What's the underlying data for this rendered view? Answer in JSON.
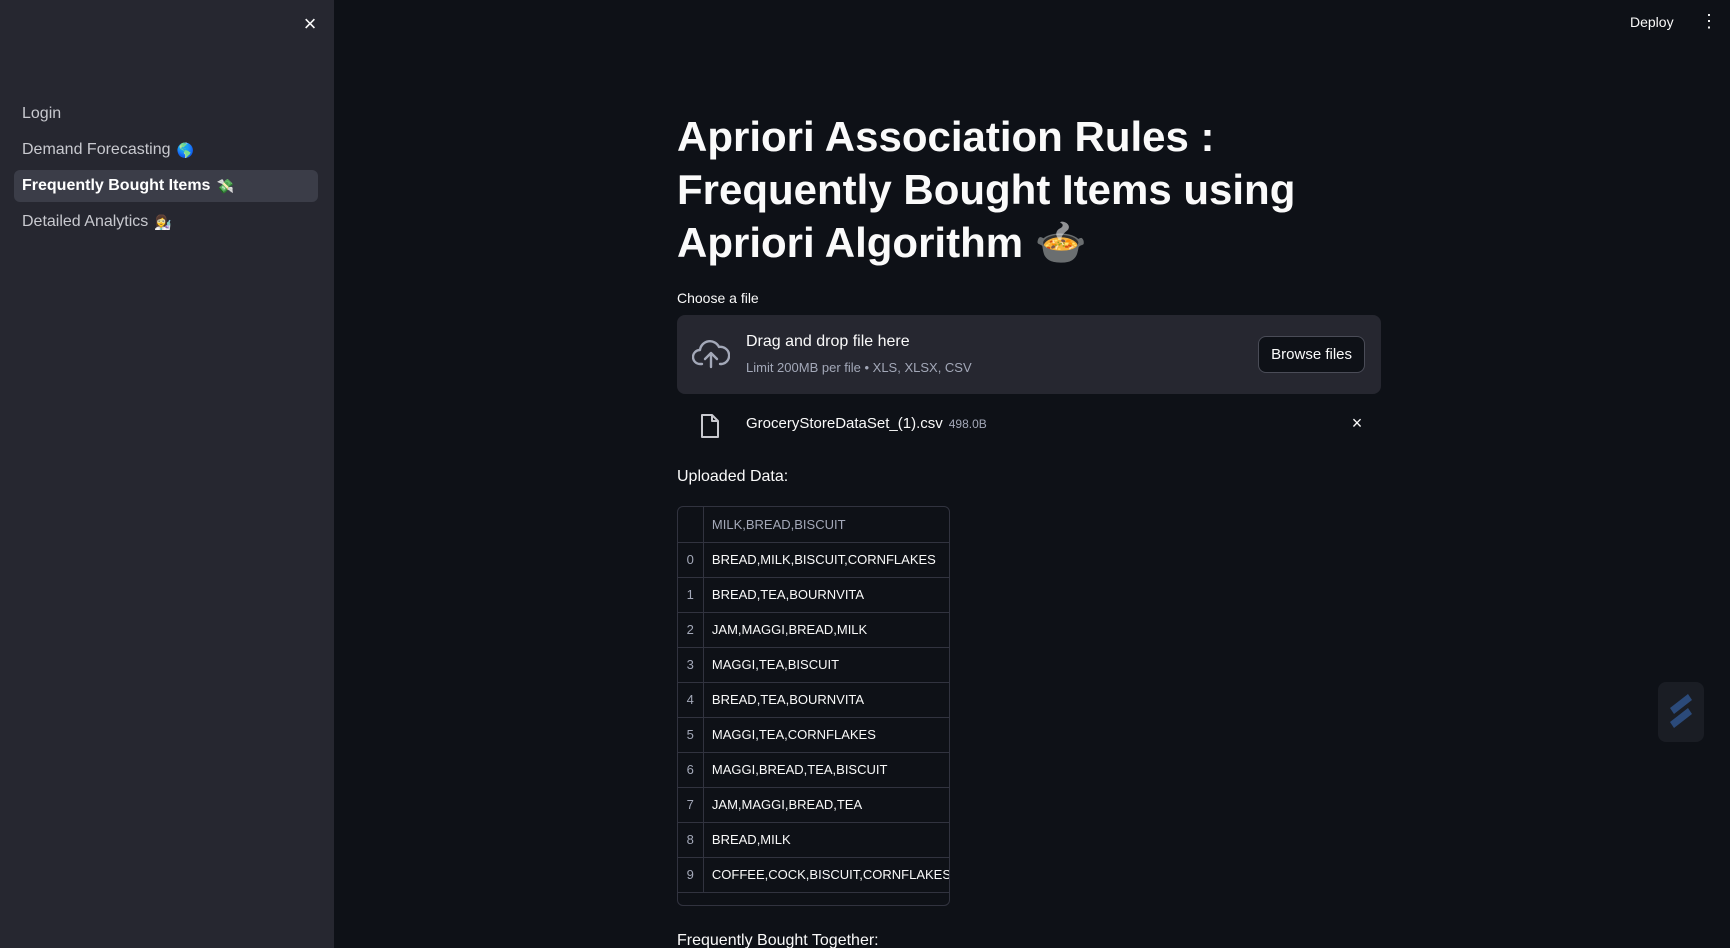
{
  "sidebar": {
    "close_icon": "×",
    "items": [
      {
        "label": "Login",
        "emoji": ""
      },
      {
        "label": "Demand Forecasting",
        "emoji": "🌎"
      },
      {
        "label": "Frequently Bought Items",
        "emoji": "💸"
      },
      {
        "label": "Detailed Analytics",
        "emoji": "👩‍🔬"
      }
    ]
  },
  "topbar": {
    "deploy": "Deploy",
    "menu_icon": "⋮"
  },
  "main": {
    "title": "Apriori Association Rules : Frequently Bought Items using Apriori Algorithm",
    "title_emoji": "🍲",
    "uploader": {
      "label": "Choose a file",
      "drag_text": "Drag and drop file here",
      "limit_text": "Limit 200MB per file • XLS, XLSX, CSV",
      "browse": "Browse files"
    },
    "file": {
      "name": "GroceryStoreDataSet_(1).csv",
      "size": "498.0B",
      "remove_icon": "×"
    },
    "uploaded_label": "Uploaded Data:",
    "table": {
      "header": "MILK,BREAD,BISCUIT",
      "rows": [
        {
          "i": "0",
          "v": "BREAD,MILK,BISCUIT,CORNFLAKES"
        },
        {
          "i": "1",
          "v": "BREAD,TEA,BOURNVITA"
        },
        {
          "i": "2",
          "v": "JAM,MAGGI,BREAD,MILK"
        },
        {
          "i": "3",
          "v": "MAGGI,TEA,BISCUIT"
        },
        {
          "i": "4",
          "v": "BREAD,TEA,BOURNVITA"
        },
        {
          "i": "5",
          "v": "MAGGI,TEA,CORNFLAKES"
        },
        {
          "i": "6",
          "v": "MAGGI,BREAD,TEA,BISCUIT"
        },
        {
          "i": "7",
          "v": "JAM,MAGGI,BREAD,TEA"
        },
        {
          "i": "8",
          "v": "BREAD,MILK"
        },
        {
          "i": "9",
          "v": "COFFEE,COCK,BISCUIT,CORNFLAKES"
        }
      ]
    },
    "frequent_label": "Frequently Bought Together:"
  }
}
